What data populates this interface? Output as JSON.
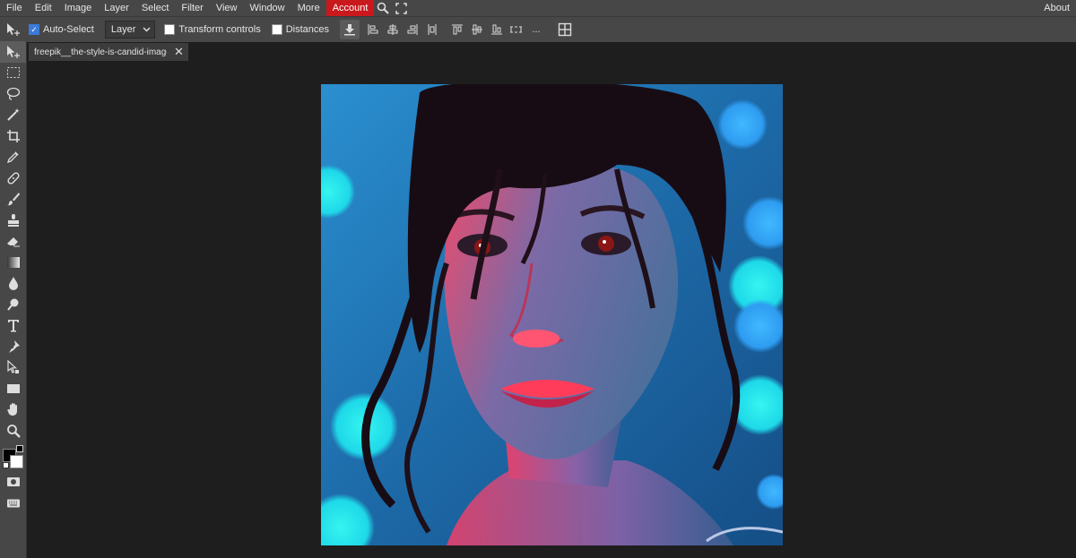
{
  "menu": {
    "items": [
      "File",
      "Edit",
      "Image",
      "Layer",
      "Select",
      "Filter",
      "View",
      "Window",
      "More"
    ],
    "account": "Account",
    "about": "About"
  },
  "options": {
    "auto_select_label": "Auto-Select",
    "auto_select_checked": true,
    "target_select_value": "Layer",
    "transform_controls_label": "Transform controls",
    "distances_label": "Distances",
    "more_label": "..."
  },
  "document": {
    "tab_name": "freepik__the-style-is-candid-image",
    "close_glyph": "✕"
  },
  "tools": [
    "move-tool",
    "marquee-tool",
    "lasso-tool",
    "magic-wand-tool",
    "crop-tool",
    "eyedropper-tool",
    "healing-tool",
    "brush-tool",
    "stamp-tool",
    "eraser-tool",
    "gradient-tool",
    "blur-tool",
    "dodge-tool",
    "type-tool",
    "pen-tool",
    "path-select-tool",
    "shape-tool",
    "hand-tool",
    "zoom-tool"
  ],
  "colors": {
    "accent": "#c9191d",
    "panel": "#474747",
    "workspace": "#1e1e1e",
    "foreground_swatch": "#000000",
    "background_swatch": "#ffffff"
  }
}
